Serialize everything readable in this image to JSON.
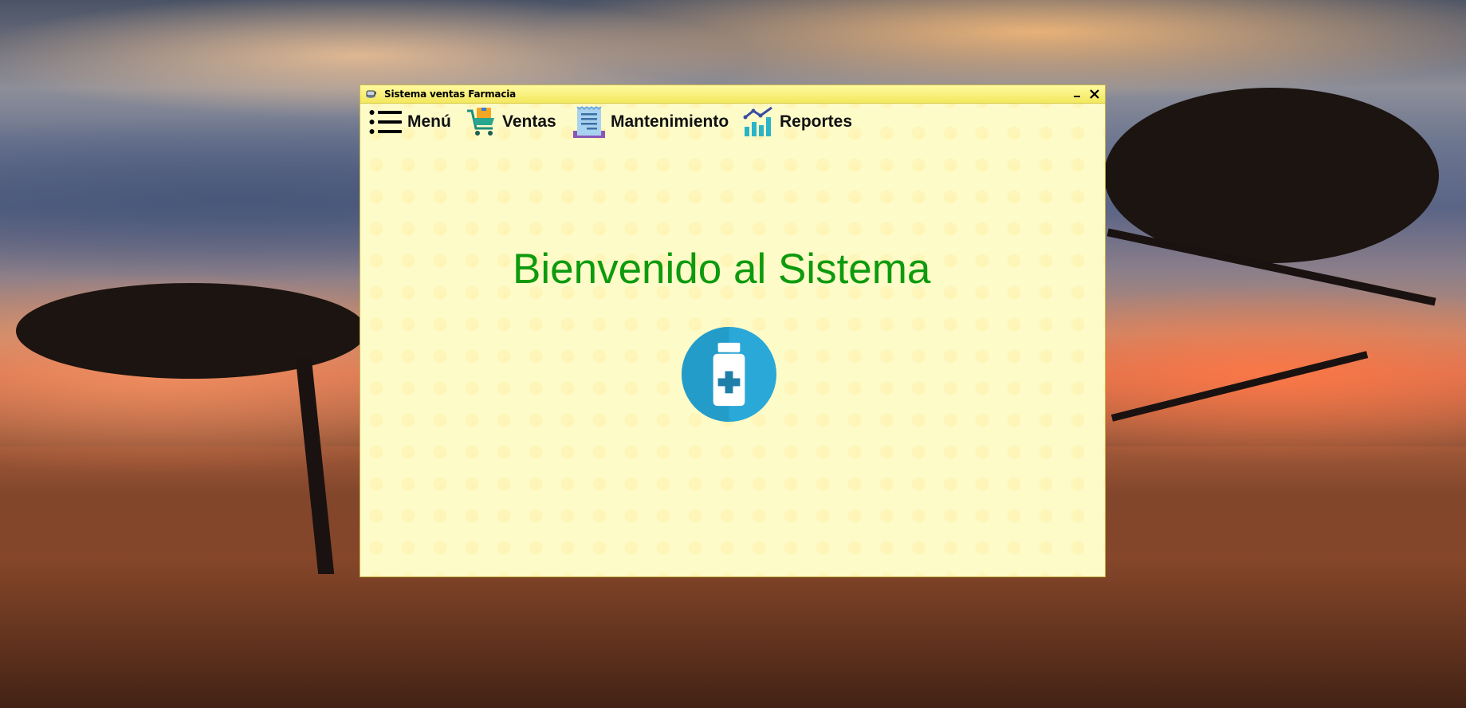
{
  "window": {
    "title": "Sistema ventas Farmacia",
    "minimize_glyph": "–",
    "close_glyph": "✕"
  },
  "menu": {
    "items": [
      {
        "label": "Menú",
        "icon": "hamburger-list-icon"
      },
      {
        "label": "Ventas",
        "icon": "shopping-cart-icon"
      },
      {
        "label": "Mantenimiento",
        "icon": "receipt-document-icon"
      },
      {
        "label": "Reportes",
        "icon": "bar-chart-icon"
      }
    ]
  },
  "main": {
    "welcome_text": "Bienvenido al Sistema",
    "logo_icon": "medicine-bottle-icon"
  },
  "colors": {
    "window_bg": "#fdfbc8",
    "titlebar": "#f2e85c",
    "welcome_text": "#0e9a0e",
    "logo_circle": "#2fa7d4"
  }
}
